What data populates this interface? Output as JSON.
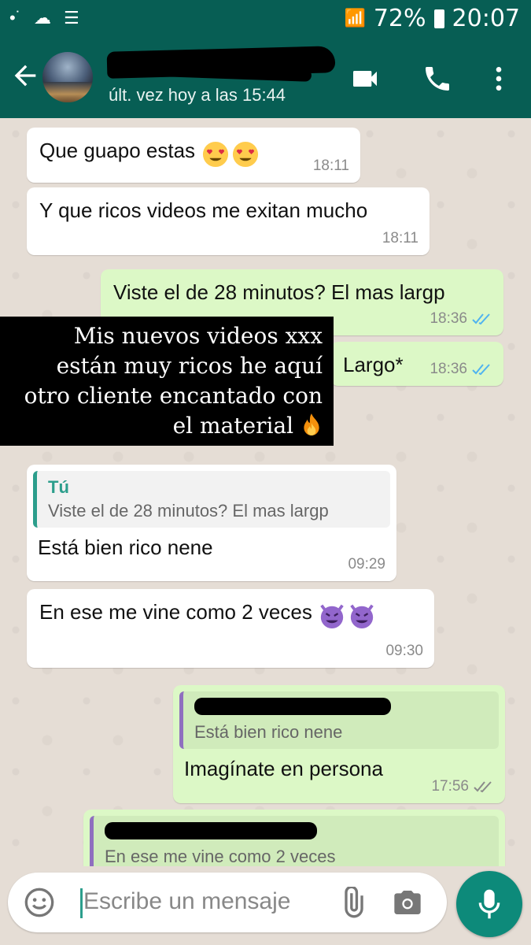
{
  "status_bar": {
    "battery": "72%",
    "time": "20:07"
  },
  "header": {
    "last_seen": "últ. vez hoy a las 15:44"
  },
  "messages": [
    {
      "text": "Que guapo estas",
      "time": "18:11"
    },
    {
      "text": "Y que ricos videos me exitan mucho",
      "time": "18:11"
    },
    {
      "text": "Viste el de 28 minutos? El mas largp",
      "time": "18:36"
    },
    {
      "text": "Largo*",
      "time": "18:36"
    },
    {
      "quote_author": "Tú",
      "quote_text": "Viste el de 28 minutos? El mas largp",
      "text": "Está bien rico nene",
      "time": "09:29"
    },
    {
      "text": "En ese me vine como 2 veces",
      "time": "09:30"
    },
    {
      "quote_text": "Está bien rico nene",
      "text": "Imagínate en persona",
      "time": "17:56"
    },
    {
      "quote_text": "En ese me vine como 2 veces"
    }
  ],
  "overlay": {
    "lines": [
      "Mis nuevos videos xxx",
      "están muy ricos he aquí",
      "otro cliente encantado con",
      "el material"
    ]
  },
  "input": {
    "placeholder": "Escribe un mensaje"
  },
  "colors": {
    "header": "#075e54",
    "outgoing": "#dcf8c6",
    "incoming": "#ffffff",
    "accent": "#0d8a7a",
    "read_tick": "#4fb3f0"
  },
  "icons": [
    "back-arrow-icon",
    "video-call-icon",
    "phone-icon",
    "more-options-icon",
    "smiley-icon",
    "attach-icon",
    "camera-icon",
    "mic-icon",
    "heart-eyes-emoji",
    "smiling-devil-emoji",
    "fire-emoji"
  ]
}
